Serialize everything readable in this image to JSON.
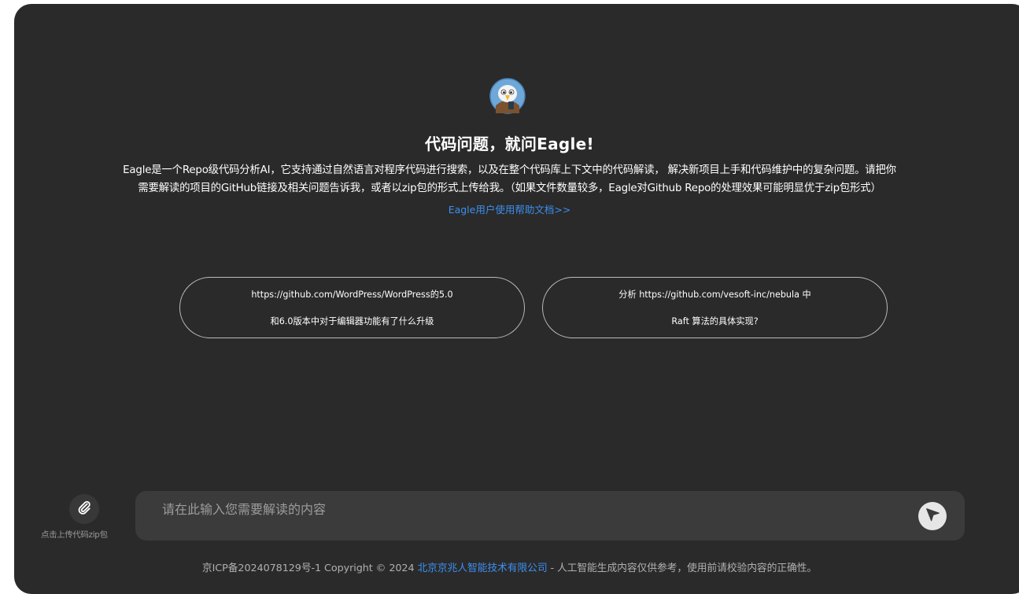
{
  "hero": {
    "title": "代码问题，就问Eagle!",
    "description_line1": "Eagle是一个Repo级代码分析AI，它支持通过自然语言对程序代码进行搜索，以及在整个代码库上下文中的代码解读， 解决新项目上手和代码维护中的复杂问题。请把你",
    "description_line2": "需要解读的项目的GitHub链接及相关问题告诉我，或者以zip包的形式上传给我。（如果文件数量较多，Eagle对Github Repo的处理效果可能明显优于zip包形式）",
    "help_link": "Eagle用户使用帮助文档>>"
  },
  "suggestions": [
    {
      "line1": "https://github.com/WordPress/WordPress的5.0",
      "line2": "和6.0版本中对于编辑器功能有了什么升级"
    },
    {
      "line1": "分析 https://github.com/vesoft-inc/nebula 中",
      "line2": "Raft 算法的具体实现?"
    }
  ],
  "composer": {
    "attach_label": "点击上传代码zip包",
    "placeholder": "请在此输入您需要解读的内容",
    "value": ""
  },
  "footer": {
    "prefix": "京ICP备2024078129号-1 Copyright © 2024 ",
    "company": "北京京兆人智能技术有限公司",
    "suffix": " - 人工智能生成内容仅供参考，使用前请校验内容的正确性。"
  },
  "colors": {
    "panel_bg": "#2a2a2a",
    "input_bg": "#3b3b3b",
    "link": "#3d8ff0"
  }
}
